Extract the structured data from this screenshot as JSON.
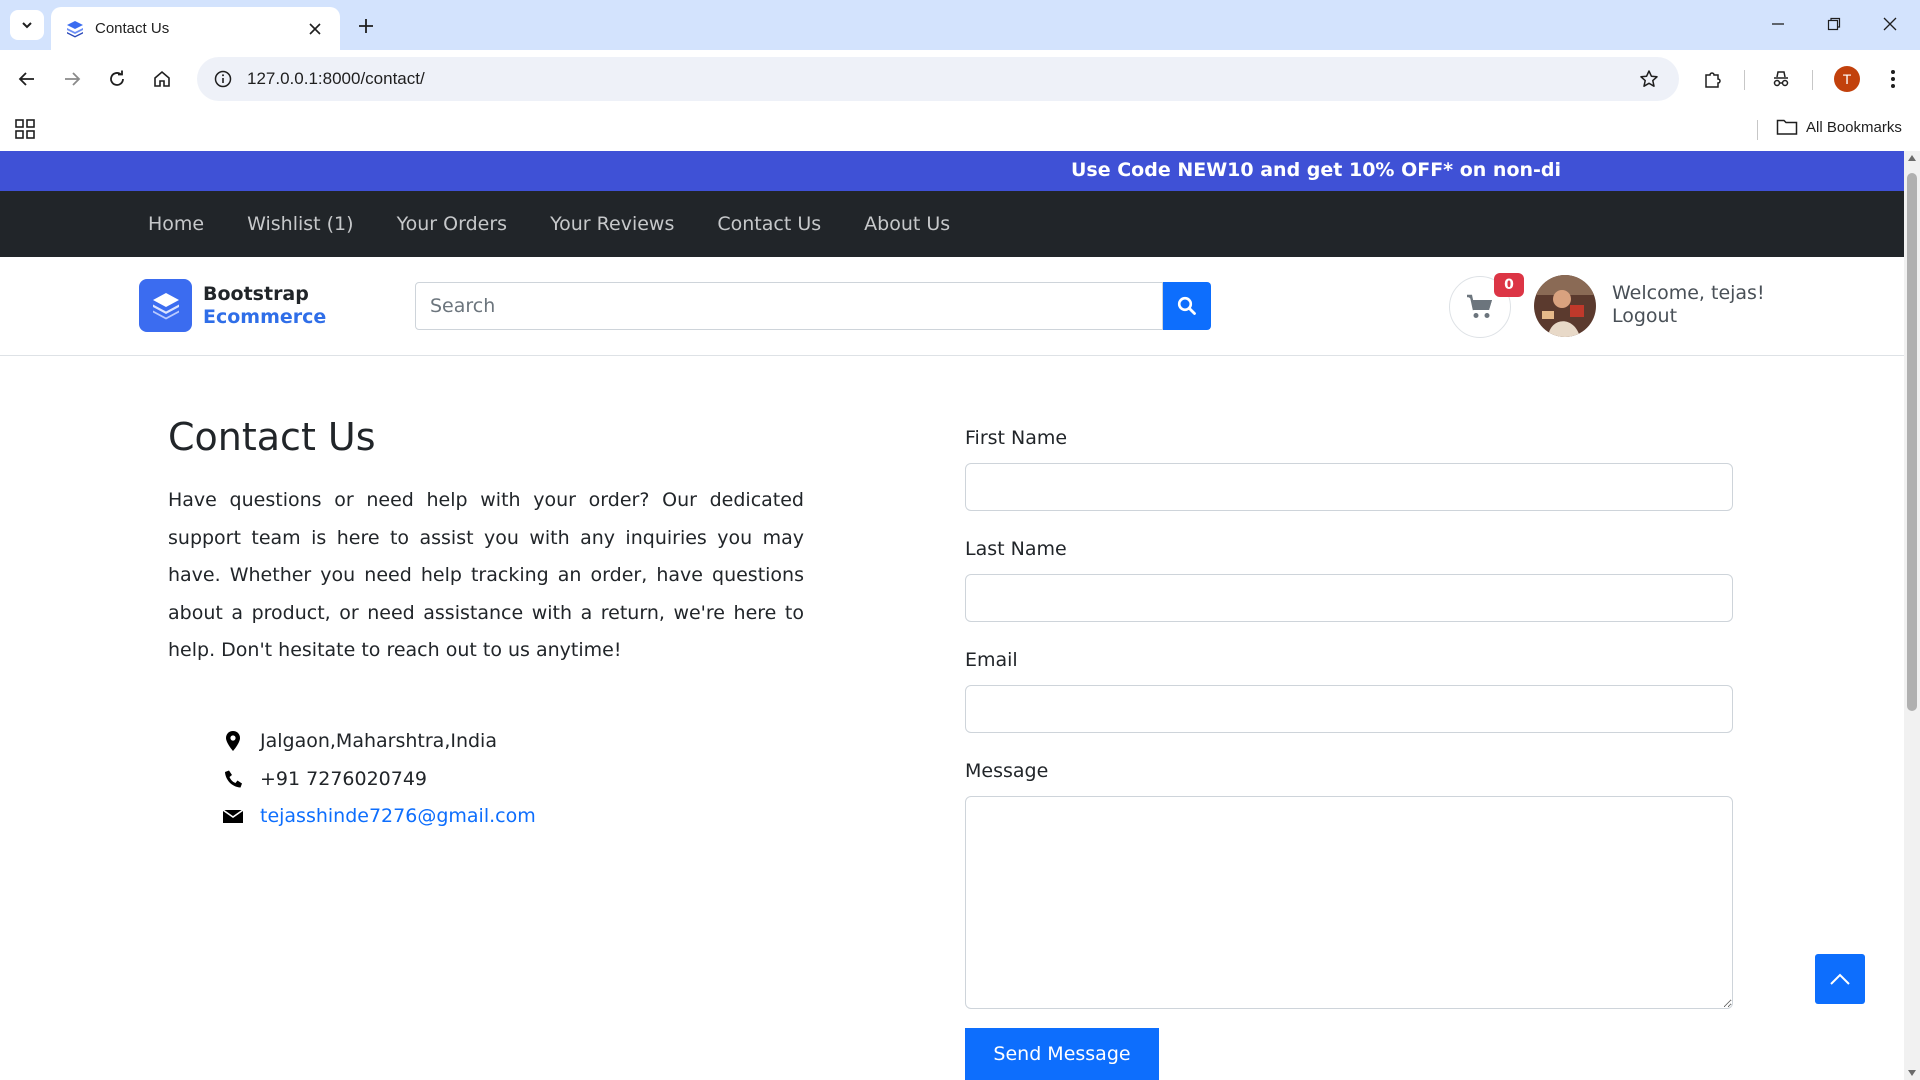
{
  "browser": {
    "tab_title": "Contact Us",
    "url": "127.0.0.1:8000/contact/",
    "profile_initial": "T",
    "bookmarks_label": "All Bookmarks"
  },
  "promo": {
    "text": "Use Code NEW10 and get 10% OFF* on non-di",
    "background": "#3f51d6"
  },
  "nav": {
    "items": [
      {
        "label": "Home"
      },
      {
        "label": "Wishlist (1)"
      },
      {
        "label": "Your Orders"
      },
      {
        "label": "Your Reviews"
      },
      {
        "label": "Contact Us"
      },
      {
        "label": "About Us"
      }
    ]
  },
  "header": {
    "logo_line1": "Bootstrap",
    "logo_line2": "Ecommerce",
    "search_placeholder": "Search",
    "cart_count": "0",
    "welcome": "Welcome, tejas!",
    "logout": "Logout"
  },
  "contact": {
    "title": "Contact Us",
    "description": "Have questions or need help with your order? Our dedicated support team is here to assist you with any inquiries you may have. Whether you need help tracking an order, have questions about a product, or need assistance with a return, we're here to help. Don't hesitate to reach out to us anytime!",
    "address": "Jalgaon,Maharshtra,India",
    "phone": "+91 7276020749",
    "email": "tejasshinde7276@gmail.com"
  },
  "form": {
    "first_name_label": "First Name",
    "last_name_label": "Last Name",
    "email_label": "Email",
    "message_label": "Message",
    "first_name_value": "",
    "last_name_value": "",
    "email_value": "",
    "message_value": "",
    "submit_label": "Send Message"
  },
  "colors": {
    "primary": "#0d6efd",
    "navbar": "#212529",
    "badge": "#dc3545"
  }
}
